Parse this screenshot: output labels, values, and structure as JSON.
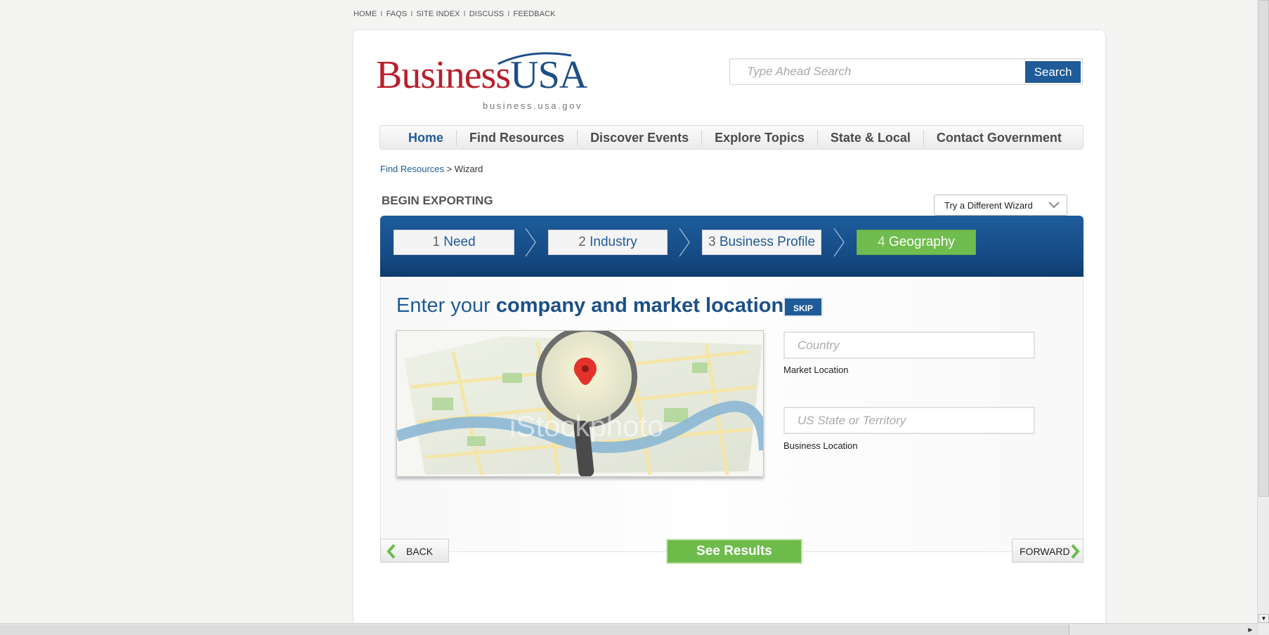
{
  "top_links": [
    "HOME",
    "FAQS",
    "SITE INDEX",
    "DISCUSS",
    "FEEDBACK"
  ],
  "top_separator": "I",
  "logo": {
    "part1": "Business",
    "part2": "USA",
    "domain": "business.usa.gov"
  },
  "search": {
    "placeholder": "Type Ahead Search",
    "button": "Search"
  },
  "main_nav": [
    "Home",
    "Find Resources",
    "Discover Events",
    "Explore Topics",
    "State & Local",
    "Contact Government"
  ],
  "breadcrumb": {
    "link": "Find Resources",
    "separator": ">",
    "current": "Wizard"
  },
  "section_title": "BEGIN EXPORTING",
  "wizard_select": "Try a Different Wizard",
  "steps": [
    {
      "num": "1",
      "label": "Need"
    },
    {
      "num": "2",
      "label": "Industry"
    },
    {
      "num": "3",
      "label": "Business Profile"
    },
    {
      "num": "4",
      "label": "Geography"
    }
  ],
  "headline": {
    "plain": "Enter your",
    "bold": "company and market location"
  },
  "skip_label": "SKIP",
  "image_watermark": "iStockphoto",
  "fields": {
    "country": {
      "placeholder": "Country",
      "label": "Market Location"
    },
    "state": {
      "placeholder": "US State or Territory",
      "label": "Business Location"
    }
  },
  "buttons": {
    "back": "BACK",
    "results": "See Results",
    "forward": "FORWARD"
  },
  "colors": {
    "brand_blue": "#1f5b98",
    "brand_red": "#b8202c",
    "active_green": "#71bc4f"
  }
}
